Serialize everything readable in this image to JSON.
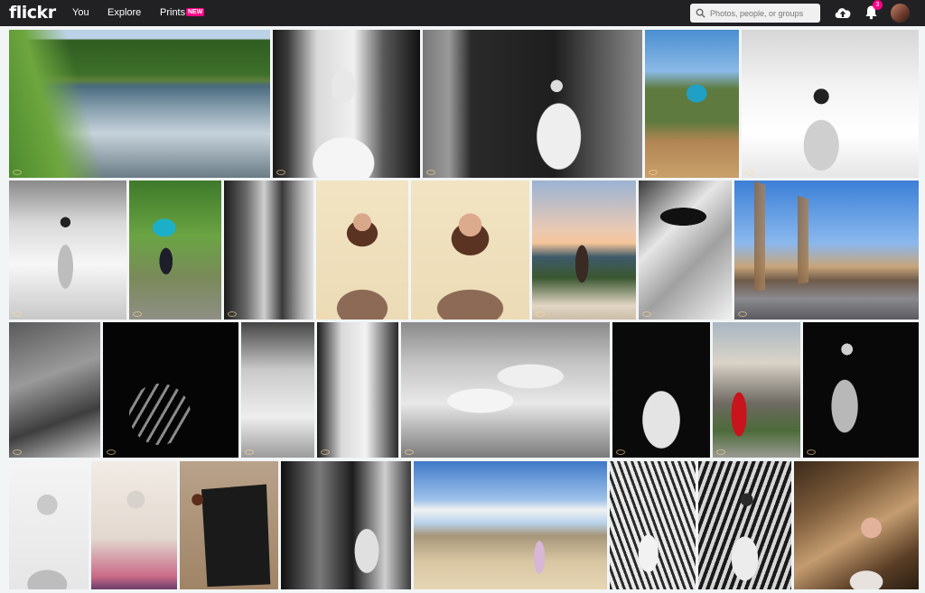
{
  "app": {
    "logo": "flickr"
  },
  "nav": {
    "you": "You",
    "explore": "Explore",
    "prints": "Prints",
    "prints_badge": "NEW"
  },
  "search": {
    "placeholder": "Photos, people, or groups"
  },
  "notifications": {
    "count": "3"
  },
  "icons": {
    "search": "search-icon",
    "upload": "upload-icon",
    "bell": "bell-icon"
  },
  "colors": {
    "topbar": "#212124",
    "accent_pink": "#ff0084",
    "background": "#f2f5f6"
  }
}
